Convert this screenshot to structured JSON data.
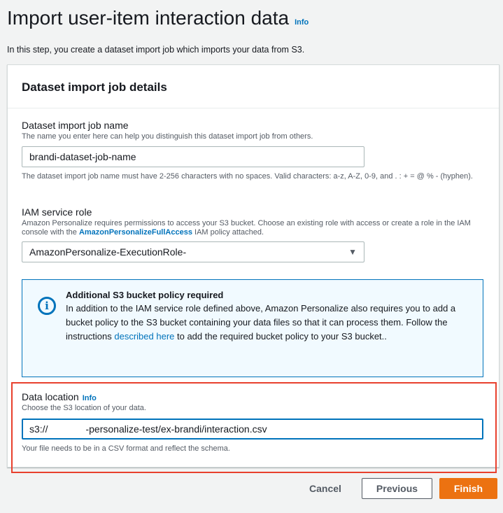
{
  "page": {
    "title": "Import user-item interaction data",
    "info_label": "Info",
    "description": "In this step, you create a dataset import job which imports your data from S3."
  },
  "container": {
    "header": "Dataset import job details"
  },
  "job_name": {
    "label": "Dataset import job name",
    "description": "The name you enter here can help you distinguish this dataset import job from others.",
    "value": "brandi-dataset-job-name",
    "constraint": "The dataset import job name must have 2-256 characters with no spaces. Valid characters: a-z, A-Z, 0-9, and . : + = @ % - (hyphen)."
  },
  "iam_role": {
    "label": "IAM service role",
    "description_before": "Amazon Personalize requires permissions to access your S3 bucket. Choose an existing role with access or create a role in the IAM console with the ",
    "description_policy": "AmazonPersonalizeFullAccess",
    "description_after": " IAM policy attached.",
    "selected": "AmazonPersonalize-ExecutionRole-"
  },
  "alert": {
    "icon": "info-circle-icon",
    "title": "Additional S3 bucket policy required",
    "body_before": "In addition to the IAM service role defined above, Amazon Personalize also requires you to add a bucket policy to the S3 bucket containing your data files so that it can process them. Follow the instructions ",
    "link": "described here",
    "body_after": " to add the required bucket policy to your S3 bucket.."
  },
  "data_location": {
    "label": "Data location",
    "info_label": "Info",
    "description": "Choose the S3 location of your data.",
    "value_prefix": "s3://",
    "value_suffix": "-personalize-test/ex-brandi/interaction.csv",
    "hint": "Your file needs to be in a CSV format and reflect the schema."
  },
  "buttons": {
    "cancel": "Cancel",
    "previous": "Previous",
    "finish": "Finish"
  },
  "colors": {
    "accent": "#0073bb",
    "primary_button": "#ec7211",
    "highlight": "#e8402d"
  }
}
